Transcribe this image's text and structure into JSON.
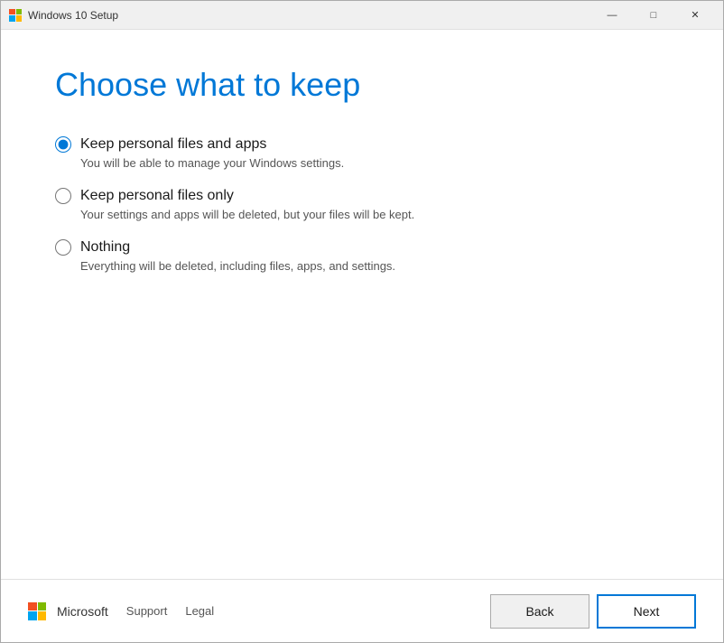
{
  "window": {
    "title": "Windows 10 Setup"
  },
  "titlebar": {
    "minimize_label": "—",
    "maximize_label": "□",
    "close_label": "✕"
  },
  "page": {
    "title": "Choose what to keep"
  },
  "options": [
    {
      "id": "keep-files-and-apps",
      "label": "Keep personal files and apps",
      "description": "You will be able to manage your Windows settings.",
      "checked": true
    },
    {
      "id": "keep-files-only",
      "label": "Keep personal files only",
      "description": "Your settings and apps will be deleted, but your files will be kept.",
      "checked": false
    },
    {
      "id": "nothing",
      "label": "Nothing",
      "description": "Everything will be deleted, including files, apps, and settings.",
      "checked": false
    }
  ],
  "footer": {
    "brand": "Microsoft",
    "support_label": "Support",
    "legal_label": "Legal",
    "back_label": "Back",
    "next_label": "Next"
  }
}
